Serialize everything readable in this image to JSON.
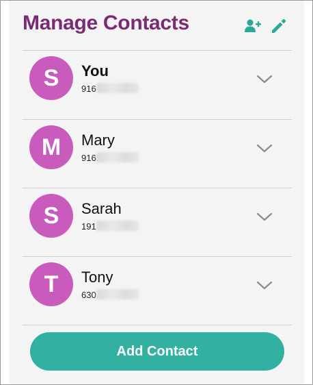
{
  "header": {
    "title": "Manage Contacts",
    "add_icon": "add-person-icon",
    "edit_icon": "pencil-icon"
  },
  "contacts": [
    {
      "initial": "S",
      "name": "You",
      "phone": "916",
      "expand_icon": "chevron-down-icon"
    },
    {
      "initial": "M",
      "name": "Mary",
      "phone": "916.",
      "expand_icon": "chevron-down-icon"
    },
    {
      "initial": "S",
      "name": "Sarah",
      "phone": "191",
      "expand_icon": "chevron-down-icon"
    },
    {
      "initial": "T",
      "name": "Tony",
      "phone": "630",
      "expand_icon": "chevron-down-icon"
    }
  ],
  "footer": {
    "add_contact_label": "Add Contact"
  },
  "colors": {
    "title": "#7a2b73",
    "avatar": "#c95bbd",
    "accent_teal": "#32b1a3",
    "icon_teal": "#2aa99b",
    "chevron": "#8a8a8a"
  }
}
